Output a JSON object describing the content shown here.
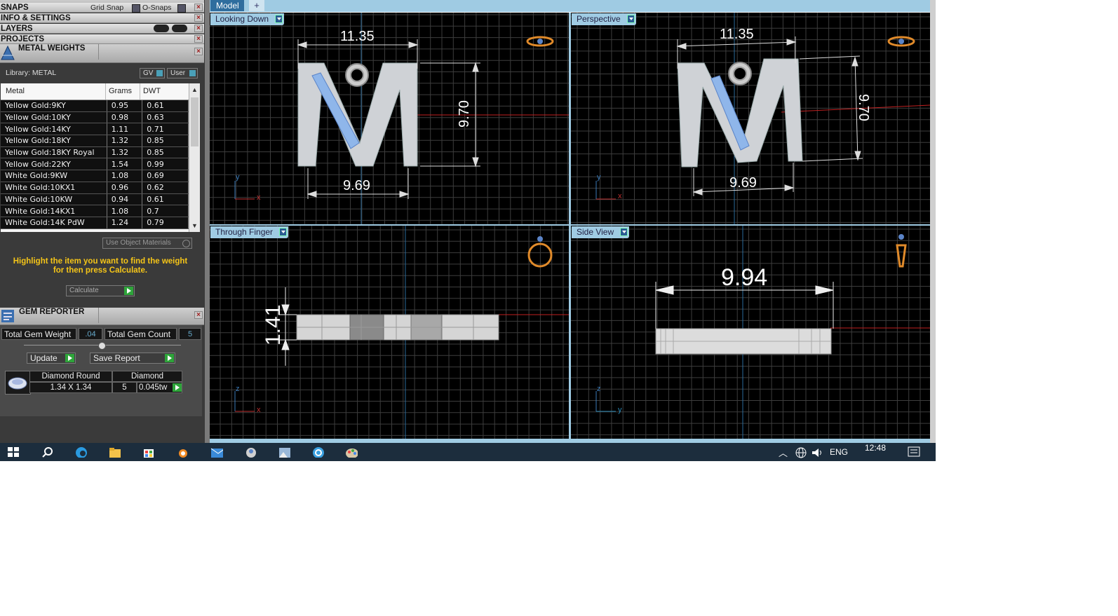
{
  "panels": {
    "snaps": {
      "title": "SNAPS",
      "grid_snap": "Grid Snap",
      "osnaps": "O-Snaps"
    },
    "info": {
      "title": "INFO & SETTINGS"
    },
    "layers": {
      "title": "LAYERS"
    },
    "projects": {
      "title": "PROJECTS"
    }
  },
  "metal_weights": {
    "title": "METAL WEIGHTS",
    "library": "Library: METAL",
    "gv": "GV",
    "user": "User",
    "columns": [
      "Metal",
      "Grams",
      "DWT"
    ],
    "rows": [
      [
        "Yellow Gold:9KY",
        "0.95",
        "0.61"
      ],
      [
        "Yellow Gold:10KY",
        "0.98",
        "0.63"
      ],
      [
        "Yellow Gold:14KY",
        "1.11",
        "0.71"
      ],
      [
        "Yellow Gold:18KY",
        "1.32",
        "0.85"
      ],
      [
        "Yellow Gold:18KY Royal",
        "1.32",
        "0.85"
      ],
      [
        "Yellow Gold:22KY",
        "1.54",
        "0.99"
      ],
      [
        "White Gold:9KW",
        "1.08",
        "0.69"
      ],
      [
        "White Gold:10KX1",
        "0.96",
        "0.62"
      ],
      [
        "White Gold:10KW",
        "0.94",
        "0.61"
      ],
      [
        "White Gold:14KX1",
        "1.08",
        "0.7"
      ],
      [
        "White Gold:14K PdW",
        "1.24",
        "0.79"
      ]
    ],
    "use_object_materials": "Use Object Materials",
    "hint": "Highlight the item you want to find the weight for then press Calculate.",
    "calculate": "Calculate",
    "hint_color": "#f5c518"
  },
  "gem_reporter": {
    "title": "GEM REPORTER",
    "total_gem_weight_label": "Total Gem Weight",
    "total_gem_weight": ".04",
    "total_gem_count_label": "Total Gem Count",
    "total_gem_count": "5",
    "update": "Update",
    "save_report": "Save Report",
    "gem": {
      "shape": "Diamond Round",
      "material": "Diamond",
      "size": "1.34 X 1.34",
      "count": "5",
      "weight": "0.045tw"
    }
  },
  "tabs": {
    "model": "Model",
    "add": "+"
  },
  "viewports": {
    "top_left": {
      "label": "Looking Down",
      "dim_top": "11.35",
      "dim_right": "9.70",
      "dim_bottom": "9.69",
      "axis_v": "y",
      "axis_h": "x"
    },
    "top_right": {
      "label": "Perspective",
      "dim_top": "11.35",
      "dim_right": "9.70",
      "dim_bottom": "9.69",
      "axis_v": "y",
      "axis_h": "x"
    },
    "bottom_left": {
      "label": "Through Finger",
      "dim_left": "1.41",
      "axis_v": "z",
      "axis_h": "x"
    },
    "bottom_right": {
      "label": "Side View",
      "dim_top": "9.94",
      "axis_v": "z",
      "axis_h": "y"
    }
  },
  "taskbar": {
    "lang": "ENG",
    "time": "12:48",
    "icons": [
      "windows-icon",
      "search-icon",
      "edge-icon",
      "explorer-icon",
      "store-icon",
      "blender-icon",
      "mail-icon",
      "app-icon",
      "photos-icon",
      "vpn-icon",
      "paint-icon"
    ]
  },
  "colors": {
    "accent_blue": "#9fcbe3",
    "grid": "#3a3a3a",
    "axis_red": "#c02020",
    "axis_blue": "#2a6a9a"
  }
}
